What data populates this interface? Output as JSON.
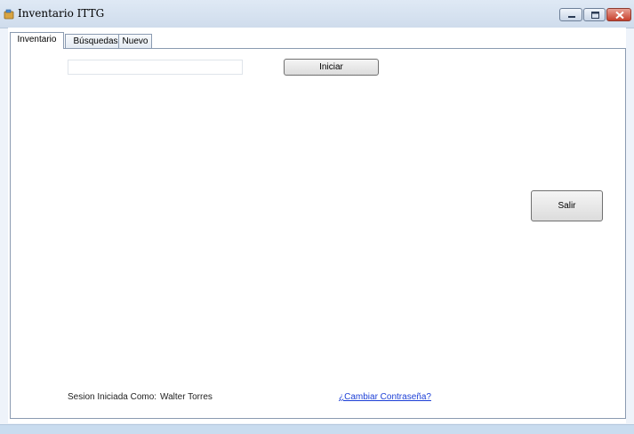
{
  "window": {
    "title": "Inventario ITTG",
    "icon": "app-icon"
  },
  "tabs": [
    {
      "label": "Inventario",
      "active": true
    },
    {
      "label": "Búsquedas",
      "active": false
    },
    {
      "label": "Nuevo",
      "active": false
    }
  ],
  "main": {
    "input_value": "",
    "iniciar_label": "Iniciar",
    "salir_label": "Salir"
  },
  "status": {
    "session_label": "Sesion Iniciada Como:",
    "user_name": "Walter Torres",
    "change_password_link": "¿Cambiar Contraseña?"
  }
}
